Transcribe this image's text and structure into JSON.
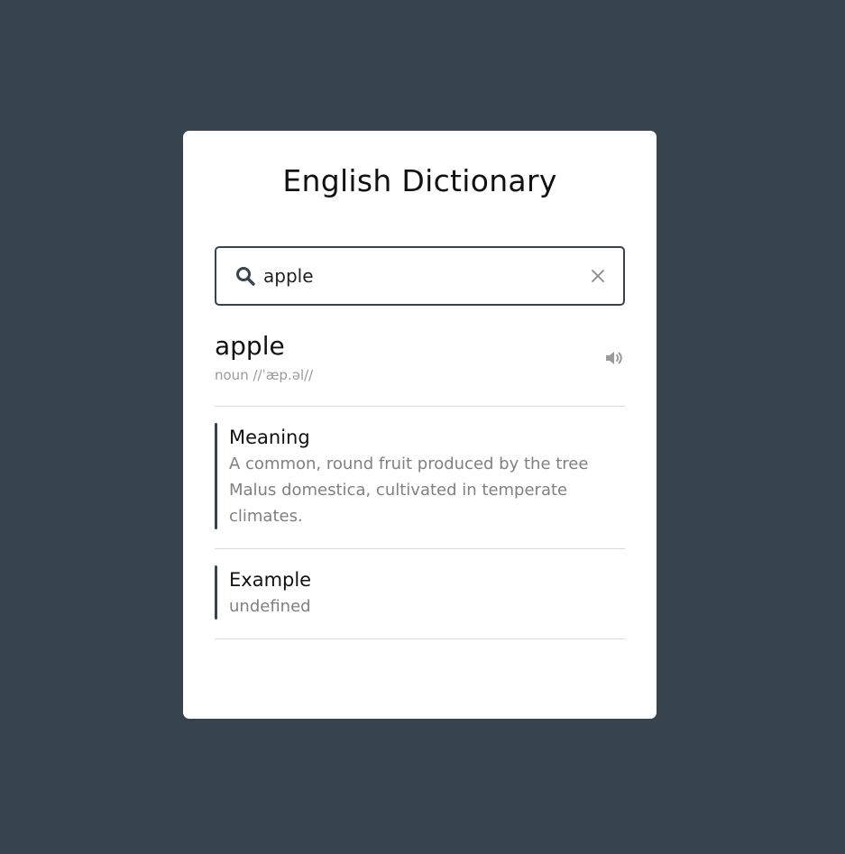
{
  "app": {
    "title": "English Dictionary"
  },
  "search": {
    "value": "apple",
    "search_icon": "search-icon",
    "clear_icon": "close-icon"
  },
  "result": {
    "word": "apple",
    "details": "noun //ˈæp.əl//",
    "speaker_icon": "volume-icon"
  },
  "meaning": {
    "label": "Meaning",
    "text": "A common, round fruit produced by the tree Malus domestica, cultivated in temperate climates."
  },
  "example": {
    "label": "Example",
    "text": "undefined"
  },
  "colors": {
    "background": "#37434d",
    "card": "#ffffff",
    "accent": "#37434d",
    "muted_text": "#808080"
  }
}
